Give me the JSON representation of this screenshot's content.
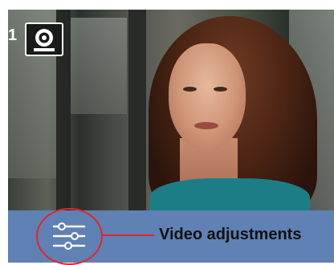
{
  "screen": {
    "channel_number": "1",
    "bottom_bar_color": "#5f81b3",
    "highlight_color": "#e2252b"
  },
  "icons": {
    "camera_icon": "camera-icon",
    "adjust_icon": "sliders-icon"
  },
  "callout": {
    "label": "Video adjustments"
  }
}
